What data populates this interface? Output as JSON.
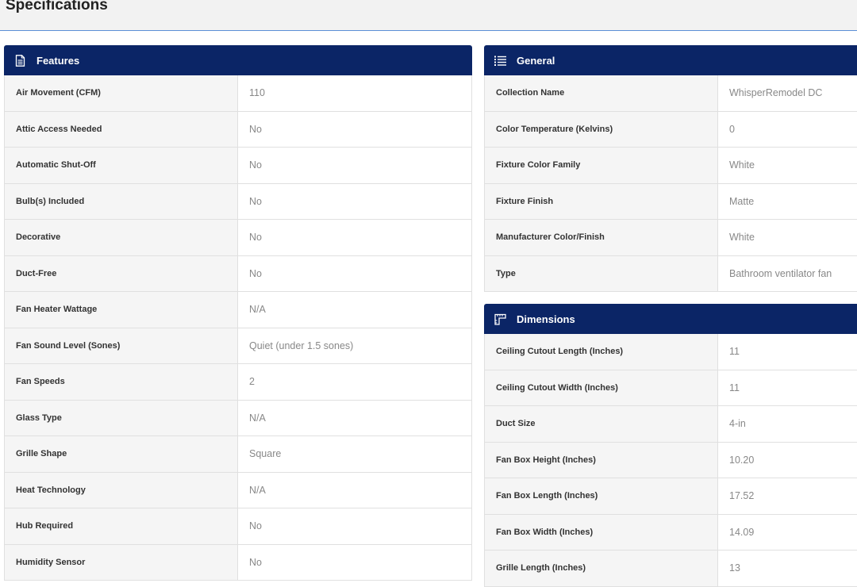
{
  "page": {
    "title": "Specifications"
  },
  "features": {
    "title": "Features",
    "rows": [
      {
        "label": "Air Movement (CFM)",
        "value": "110"
      },
      {
        "label": "Attic Access Needed",
        "value": "No"
      },
      {
        "label": "Automatic Shut-Off",
        "value": "No"
      },
      {
        "label": "Bulb(s) Included",
        "value": "No"
      },
      {
        "label": "Decorative",
        "value": "No"
      },
      {
        "label": "Duct-Free",
        "value": "No"
      },
      {
        "label": "Fan Heater Wattage",
        "value": "N/A"
      },
      {
        "label": "Fan Sound Level (Sones)",
        "value": "Quiet (under 1.5 sones)"
      },
      {
        "label": "Fan Speeds",
        "value": "2"
      },
      {
        "label": "Glass Type",
        "value": "N/A"
      },
      {
        "label": "Grille Shape",
        "value": "Square"
      },
      {
        "label": "Heat Technology",
        "value": "N/A"
      },
      {
        "label": "Hub Required",
        "value": "No"
      },
      {
        "label": "Humidity Sensor",
        "value": "No"
      }
    ]
  },
  "general": {
    "title": "General",
    "rows": [
      {
        "label": "Collection Name",
        "value": "WhisperRemodel DC"
      },
      {
        "label": "Color Temperature (Kelvins)",
        "value": "0"
      },
      {
        "label": "Fixture Color Family",
        "value": "White"
      },
      {
        "label": "Fixture Finish",
        "value": "Matte"
      },
      {
        "label": "Manufacturer Color/Finish",
        "value": "White"
      },
      {
        "label": "Type",
        "value": "Bathroom ventilator fan"
      }
    ]
  },
  "dimensions": {
    "title": "Dimensions",
    "rows": [
      {
        "label": "Ceiling Cutout Length (Inches)",
        "value": "11"
      },
      {
        "label": "Ceiling Cutout Width (Inches)",
        "value": "11"
      },
      {
        "label": "Duct Size",
        "value": "4-in"
      },
      {
        "label": "Fan Box Height (Inches)",
        "value": "10.20"
      },
      {
        "label": "Fan Box Length (Inches)",
        "value": "17.52"
      },
      {
        "label": "Fan Box Width (Inches)",
        "value": "14.09"
      },
      {
        "label": "Grille Length (Inches)",
        "value": "13"
      }
    ]
  },
  "icons": {
    "features": "document-icon",
    "general": "list-icon",
    "dimensions": "ruler-icon"
  },
  "colors": {
    "header_bg": "#0b2566",
    "label_bg": "#f5f5f5",
    "value_text": "#888888",
    "divider_accent": "#5b8fd6"
  }
}
